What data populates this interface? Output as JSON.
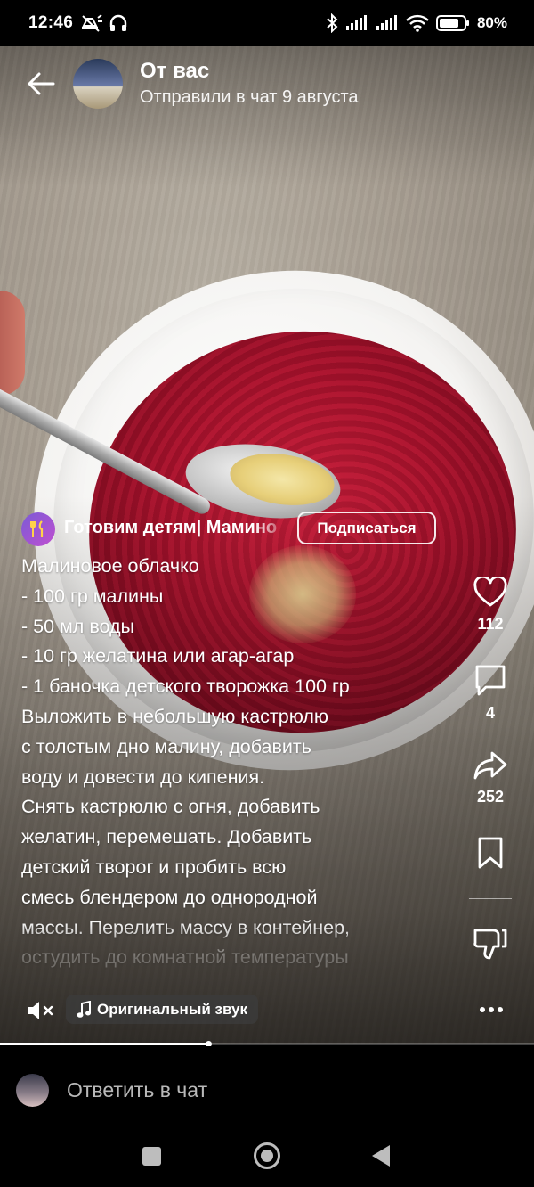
{
  "status_bar": {
    "time": "12:46",
    "battery": "80%",
    "icons": [
      "alarm-off-icon",
      "headphones-icon",
      "bluetooth-icon",
      "signal-icon",
      "signal-icon",
      "wifi-icon",
      "battery-icon"
    ]
  },
  "header": {
    "title": "От вас",
    "subtitle": "Отправили в чат 9 августа"
  },
  "creator": {
    "name": "Готовим детям| Мамино",
    "subscribe_label": "Подписаться",
    "avatar_icon": "fork-knife-icon"
  },
  "caption": {
    "lines": [
      "Малиновое облачко",
      "- 100 гр малины",
      "- 50 мл воды",
      "- 10 гр желатина или агар-агар",
      "- 1 баночка детского творожка 100 гр",
      "Выложить в небольшую кастрюлю",
      "с толстым дно малину, добавить",
      "воду и довести до кипения.",
      "Снять кастрюлю с огня, добавить",
      "желатин, перемешать. Добавить",
      "детский творог и пробить всю",
      "смесь блендером до однородной",
      "массы.  Перелить массу в контейнер,",
      "остудить до комнатной температуры"
    ]
  },
  "actions": {
    "likes": "112",
    "comments": "4",
    "shares": "252"
  },
  "audio": {
    "label": "Оригинальный звук"
  },
  "progress": {
    "fraction": 0.39
  },
  "reply": {
    "placeholder": "Ответить в чат"
  }
}
